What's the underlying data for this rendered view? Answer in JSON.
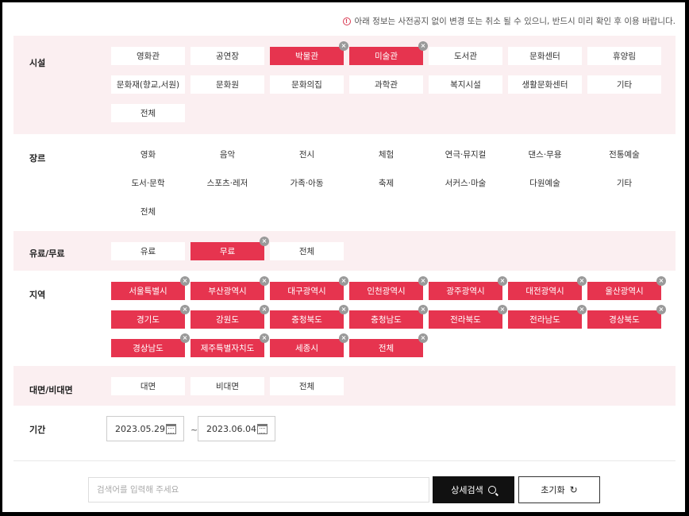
{
  "notice": "아래 정보는 사전공지 없이 변경 또는 취소 될 수 있으니, 반드시 미리 확인 후 이용 바랍니다.",
  "facility": {
    "label": "시설",
    "options": [
      {
        "label": "영화관",
        "active": false
      },
      {
        "label": "공연장",
        "active": false
      },
      {
        "label": "박물관",
        "active": true
      },
      {
        "label": "미술관",
        "active": true
      },
      {
        "label": "도서관",
        "active": false
      },
      {
        "label": "문화센터",
        "active": false
      },
      {
        "label": "휴양림",
        "active": false
      },
      {
        "label": "문화재(향교,서원)",
        "active": false
      },
      {
        "label": "문화원",
        "active": false
      },
      {
        "label": "문화의집",
        "active": false
      },
      {
        "label": "과학관",
        "active": false
      },
      {
        "label": "복지시설",
        "active": false
      },
      {
        "label": "생활문화센터",
        "active": false
      },
      {
        "label": "기타",
        "active": false
      },
      {
        "label": "전체",
        "active": false
      }
    ]
  },
  "genre": {
    "label": "장르",
    "options": [
      {
        "label": "영화",
        "active": false
      },
      {
        "label": "음악",
        "active": false
      },
      {
        "label": "전시",
        "active": false
      },
      {
        "label": "체험",
        "active": false
      },
      {
        "label": "연극·뮤지컬",
        "active": false
      },
      {
        "label": "댄스·무용",
        "active": false
      },
      {
        "label": "전통예술",
        "active": false
      },
      {
        "label": "도서·문학",
        "active": false
      },
      {
        "label": "스포츠·레저",
        "active": false
      },
      {
        "label": "가족·아동",
        "active": false
      },
      {
        "label": "축제",
        "active": false
      },
      {
        "label": "서커스·마술",
        "active": false
      },
      {
        "label": "다원예술",
        "active": false
      },
      {
        "label": "기타",
        "active": false
      },
      {
        "label": "전체",
        "active": false
      }
    ]
  },
  "fee": {
    "label": "유료/무료",
    "options": [
      {
        "label": "유료",
        "active": false
      },
      {
        "label": "무료",
        "active": true
      },
      {
        "label": "전체",
        "active": false
      }
    ]
  },
  "region": {
    "label": "지역",
    "options": [
      {
        "label": "서울특별시",
        "active": true
      },
      {
        "label": "부산광역시",
        "active": true
      },
      {
        "label": "대구광역시",
        "active": true
      },
      {
        "label": "인천광역시",
        "active": true
      },
      {
        "label": "광주광역시",
        "active": true
      },
      {
        "label": "대전광역시",
        "active": true
      },
      {
        "label": "울산광역시",
        "active": true
      },
      {
        "label": "경기도",
        "active": true
      },
      {
        "label": "강원도",
        "active": true
      },
      {
        "label": "충청북도",
        "active": true
      },
      {
        "label": "충청남도",
        "active": true
      },
      {
        "label": "전라북도",
        "active": true
      },
      {
        "label": "전라남도",
        "active": true
      },
      {
        "label": "경상북도",
        "active": true
      },
      {
        "label": "경상남도",
        "active": true
      },
      {
        "label": "제주특별자치도",
        "active": true
      },
      {
        "label": "세종시",
        "active": true
      },
      {
        "label": "전체",
        "active": true
      }
    ]
  },
  "mode": {
    "label": "대면/비대면",
    "options": [
      {
        "label": "대면",
        "active": false
      },
      {
        "label": "비대면",
        "active": false
      },
      {
        "label": "전체",
        "active": false
      }
    ]
  },
  "period": {
    "label": "기간",
    "start": "2023.05.29",
    "separator": "~",
    "end": "2023.06.04"
  },
  "search": {
    "placeholder": "검색어를 입력해 주세요",
    "detail_label": "상세검색",
    "reset_label": "초기화"
  },
  "colors": {
    "accent": "#e6344f",
    "pink_bg": "#fbeff1"
  }
}
